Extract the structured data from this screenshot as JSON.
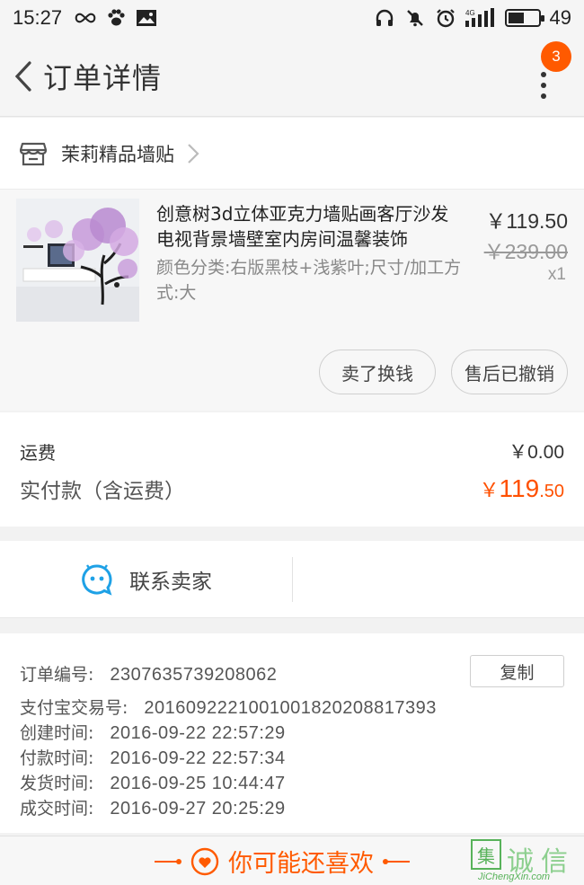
{
  "status_bar": {
    "time": "15:27",
    "network_label": "4G",
    "battery": "49",
    "battery_level": 0.55
  },
  "nav": {
    "title": "订单详情",
    "badge_count": "3",
    "back_icon": "chevron-left-icon",
    "more_icon": "more-vertical-icon"
  },
  "shop": {
    "name": "茉莉精品墙贴",
    "icon": "shop-icon"
  },
  "item": {
    "title": "创意树3d立体亚克力墙贴画客厅沙发电视背景墙壁室内房间温馨装饰",
    "sku": "颜色分类:右版黑枝+浅紫叶;尺寸/加工方式:大",
    "price": "￥119.50",
    "original_price": "￥239.00",
    "quantity": "x1",
    "sell_button": "卖了换钱",
    "aftersale_button": "售后已撤销"
  },
  "fees": {
    "shipping_label": "运费",
    "shipping_value": "￥0.00",
    "paid_label": "实付款（含运费）",
    "paid_currency": "￥",
    "paid_integer": "119",
    "paid_decimal": ".50",
    "accent_color": "#ff5000"
  },
  "contact": {
    "label": "联系卖家",
    "icon": "chat-bubble-icon",
    "icon_color": "#1ea1e6"
  },
  "order_info": {
    "copy_button": "复制",
    "rows": [
      {
        "key": "订单编号:",
        "value": "2307635739208062"
      },
      {
        "key": "支付宝交易号:",
        "value": "2016092221001001820208817393"
      },
      {
        "key": "创建时间:",
        "value": "2016-09-22 22:57:29"
      },
      {
        "key": "付款时间:",
        "value": "2016-09-22 22:57:34"
      },
      {
        "key": "发货时间:",
        "value": "2016-09-25 10:44:47"
      },
      {
        "key": "成交时间:",
        "value": "2016-09-27 20:25:29"
      }
    ]
  },
  "recommend": {
    "text": "你可能还喜欢",
    "icon": "heart-icon"
  },
  "watermark": {
    "chars": [
      "集",
      "诚",
      "信"
    ],
    "site": "JiChengXin.com"
  }
}
